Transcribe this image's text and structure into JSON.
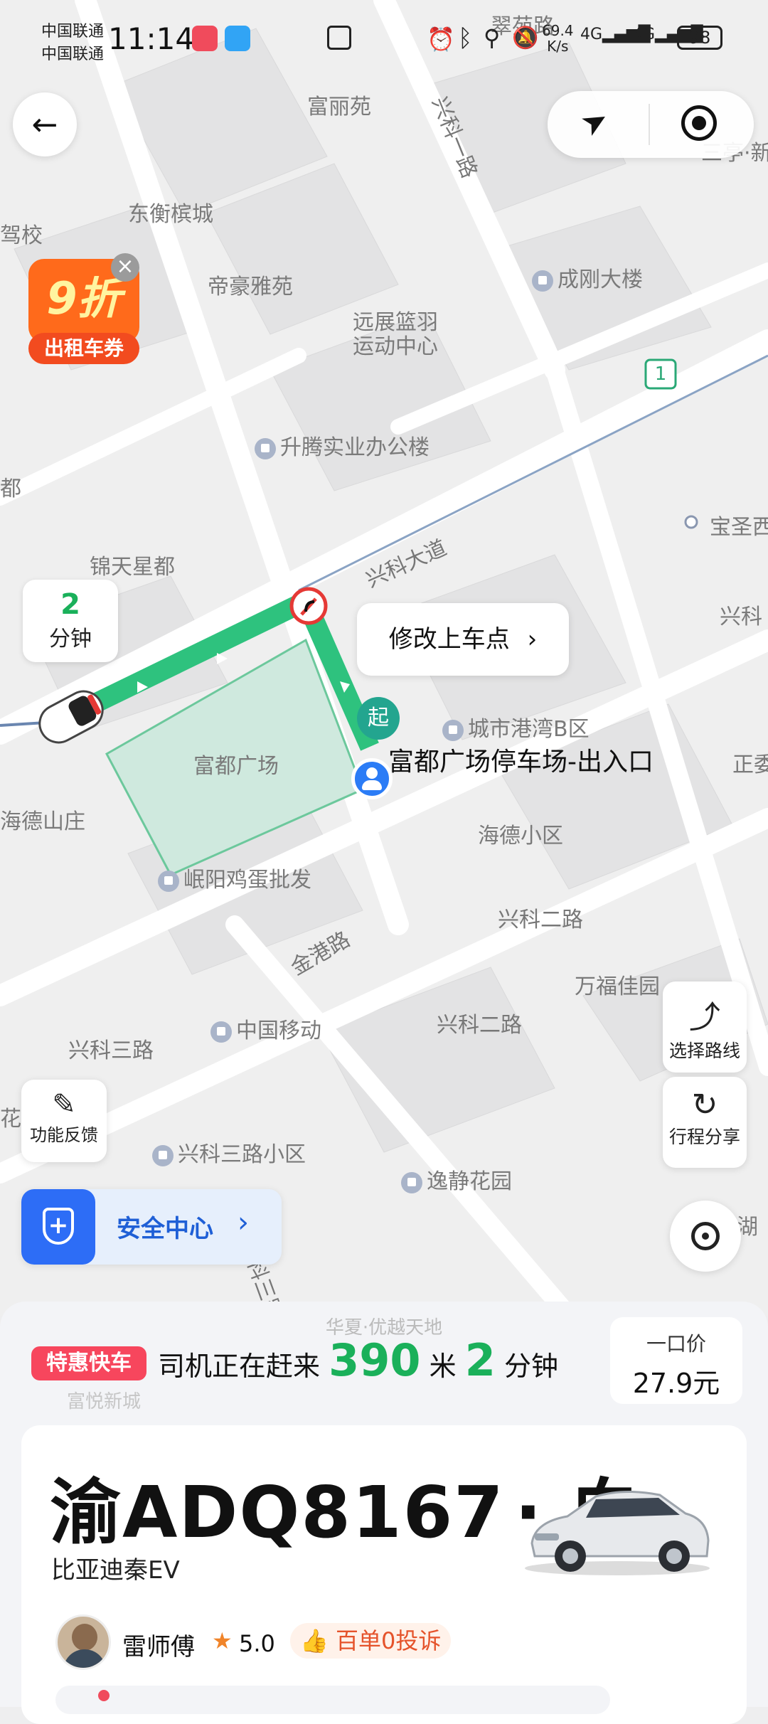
{
  "status_bar": {
    "carrier_1": "中国联通",
    "carrier_2": "中国联通",
    "time": "11:14",
    "network_speed": "69.4",
    "network_unit": "K/s",
    "battery": "98"
  },
  "map": {
    "labels": {
      "fuli_yuan": "富丽苑",
      "dongheng": "东衡槟城",
      "dihao": "帝豪雅苑",
      "yuanzhan": "远展篮羽",
      "yuanzhan_2": "运动中心",
      "chenggang": "成刚大楼",
      "shengteng": "升腾实业办公楼",
      "jintian": "锦天星都",
      "fudu": "富都广场",
      "chengshi": "城市港湾B区",
      "haide_shan": "海德山庄",
      "haide": "海德小区",
      "minyang": "岷阳鸡蛋批发",
      "zhongguo_yidong": "中国移动",
      "wanfu": "万福佳园",
      "xingke3_xq": "兴科三路小区",
      "yijing": "逸静花园",
      "baosheng": "宝圣西",
      "shuijing": "驾校",
      "du": "都",
      "huayuan": "花园",
      "zheng": "正委",
      "hu": "湖",
      "cui": "翠苑路",
      "sanheng": "三亭·新",
      "xingke_side": "兴科",
      "fuyue": "富悦新城",
      "huadu": "华夏·优越天地"
    },
    "roads": {
      "xingke_yilu": "兴科一路",
      "xingke_dadao": "兴科大道",
      "jingang": "金港路",
      "xingke_erlu_1": "兴科二路",
      "xingke_erlu_2": "兴科二路",
      "xingke_sanlu": "兴科三路",
      "keshan": "科三路"
    },
    "road_number": "1",
    "eta_minutes": "2",
    "eta_unit": "分钟",
    "modify_pickup": "修改上车点",
    "start_marker": "起",
    "pickup_name": "富都广场停车场-出入口"
  },
  "coupon": {
    "discount": "9折",
    "label": "出租车券"
  },
  "side_buttons": {
    "route": "选择路线",
    "share": "行程分享",
    "feedback": "功能反馈"
  },
  "safety": {
    "label": "安全中心"
  },
  "trip": {
    "tag": "特惠快车",
    "status_prefix": "司机正在赶来",
    "distance": "390",
    "distance_unit": "米",
    "minutes": "2",
    "minutes_unit": "分钟",
    "price_label": "一口价",
    "price": "27.9元"
  },
  "driver": {
    "plate": "渝ADQ8167",
    "color": "· 白",
    "car_model": "比亚迪秦EV",
    "name": "雷师傅",
    "rating": "5.0",
    "badge": "百单0投诉"
  },
  "colors": {
    "route_green": "#2ec27e",
    "accent_green": "#1ab05a",
    "tag_red": "#f7465d",
    "safety_blue": "#2d6df6"
  }
}
